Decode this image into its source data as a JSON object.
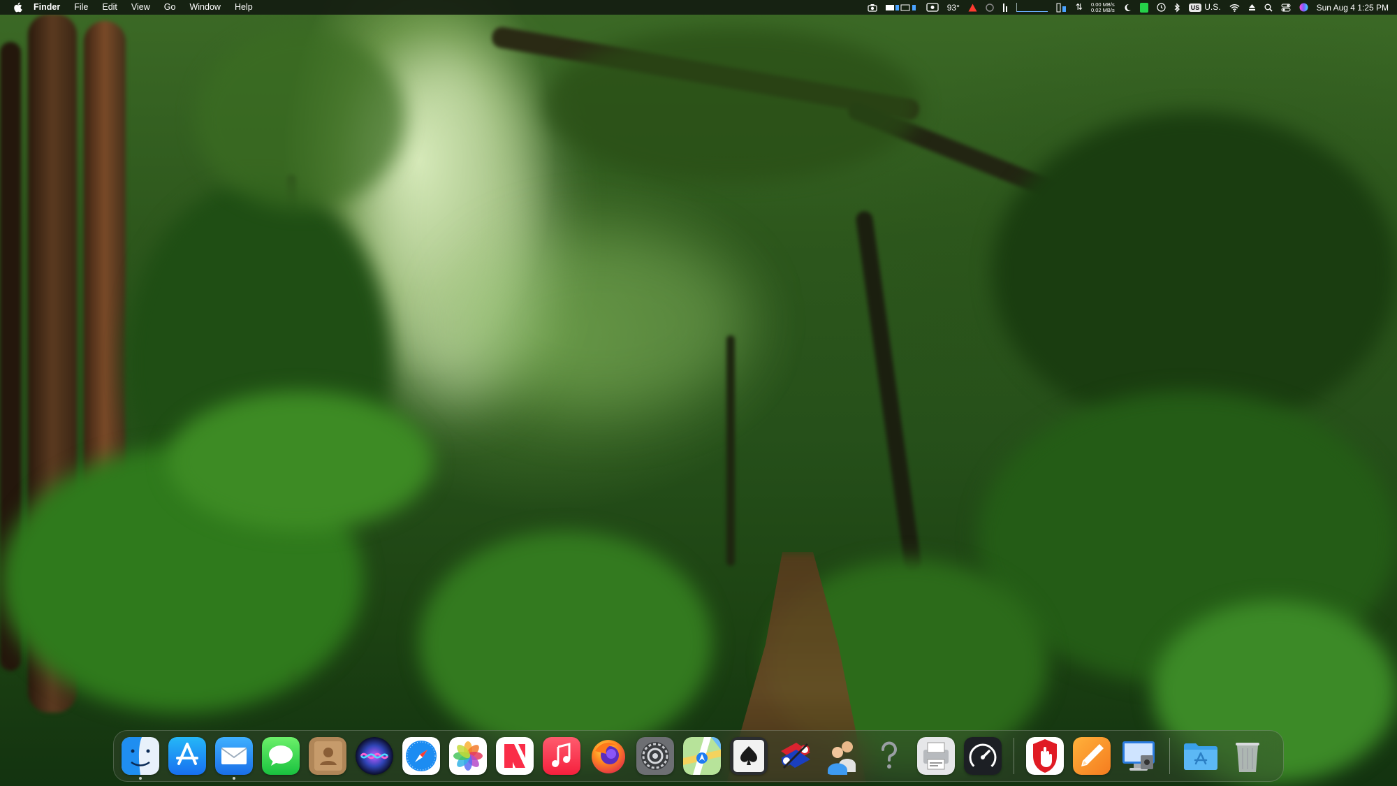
{
  "menubar": {
    "app_name": "Finder",
    "menus": [
      "File",
      "Edit",
      "View",
      "Go",
      "Window",
      "Help"
    ],
    "status": {
      "temperature": "93°",
      "net_upload": "0.00 MB/s",
      "net_download": "0.02 MB/s",
      "input_source_badge": "US",
      "input_source_label": "U.S.",
      "datetime": "Sun Aug 4  1:25 PM"
    }
  },
  "dock": {
    "apps": [
      "finder-icon",
      "app-store-icon",
      "mail-icon",
      "messages-icon",
      "contacts-icon",
      "siri-icon",
      "safari-icon",
      "photos-icon",
      "news-icon",
      "music-icon",
      "firefox-icon",
      "system-preferences-icon",
      "maps-icon",
      "solitaire-icon",
      "network-utility-icon",
      "users-icon",
      "help-icon",
      "printer-icon",
      "activity-speed-icon",
      "stop-hand-icon",
      "pages-pen-icon",
      "remote-desktop-icon",
      "applications-folder-icon",
      "trash-icon"
    ]
  },
  "colors": {
    "menubar_bg": "#141c10",
    "dock_bg": "#37482f",
    "running_dot": "#ffffff"
  }
}
